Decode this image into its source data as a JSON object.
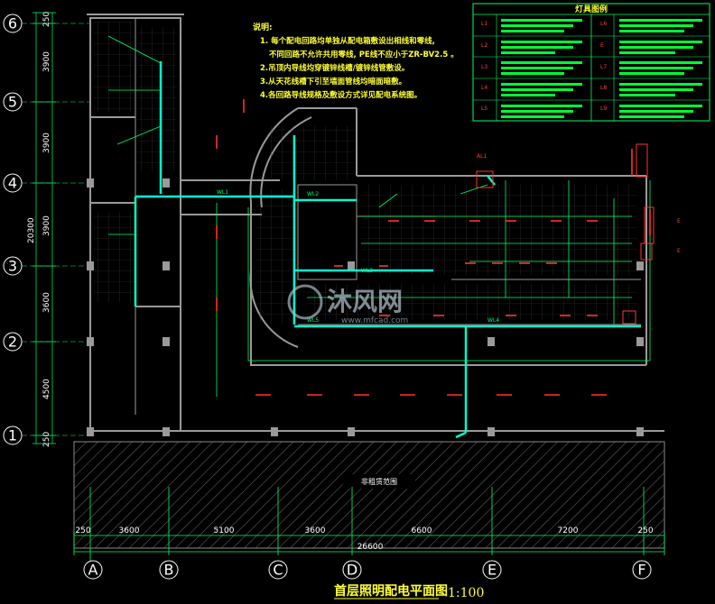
{
  "drawing": {
    "title": "首层照明配电平面图",
    "scale": "1:100",
    "non_scope_label": "非租赁范围"
  },
  "grid_rows": [
    "6",
    "5",
    "4",
    "3",
    "2",
    "1"
  ],
  "grid_cols": [
    "A",
    "B",
    "C",
    "D",
    "E",
    "F"
  ],
  "row_dims": [
    "250",
    "3900",
    "3900",
    "3900",
    "3600",
    "4500",
    "250"
  ],
  "row_total": "20300",
  "col_dims": [
    "250",
    "3600",
    "5100",
    "3600",
    "6600",
    "7200",
    "250"
  ],
  "col_total": "26600",
  "notes": {
    "title": "说明:",
    "lines": [
      "1. 每个配电回路均单独从配电箱敷设出相线和零线,",
      "不同回路不允许共用零线, PE线不应小于ZR-BV2.5 。",
      "2.吊顶内导线均穿镀锌线槽/镀锌线管敷设。",
      "3.从天花线槽下引至墙面管线均暗面暗敷。",
      "4.各回路导线规格及敷设方式详见配电系统图。"
    ]
  },
  "legend": {
    "title": "灯具图例",
    "codes": [
      "L1",
      "L2",
      "L3",
      "L4",
      "L5",
      "L6",
      "E",
      "L7",
      "L8",
      "L9"
    ]
  },
  "watermark": {
    "brand": "沐风网",
    "url": "www.mfcad.com"
  },
  "colors": {
    "background": "#000000",
    "wall": "#9a9a9a",
    "grid_text": "#ffffff",
    "circuit": "#00ff66",
    "trunking": "#00ffcc",
    "fixture": "#ff3333",
    "annotation": "#ffff33"
  }
}
